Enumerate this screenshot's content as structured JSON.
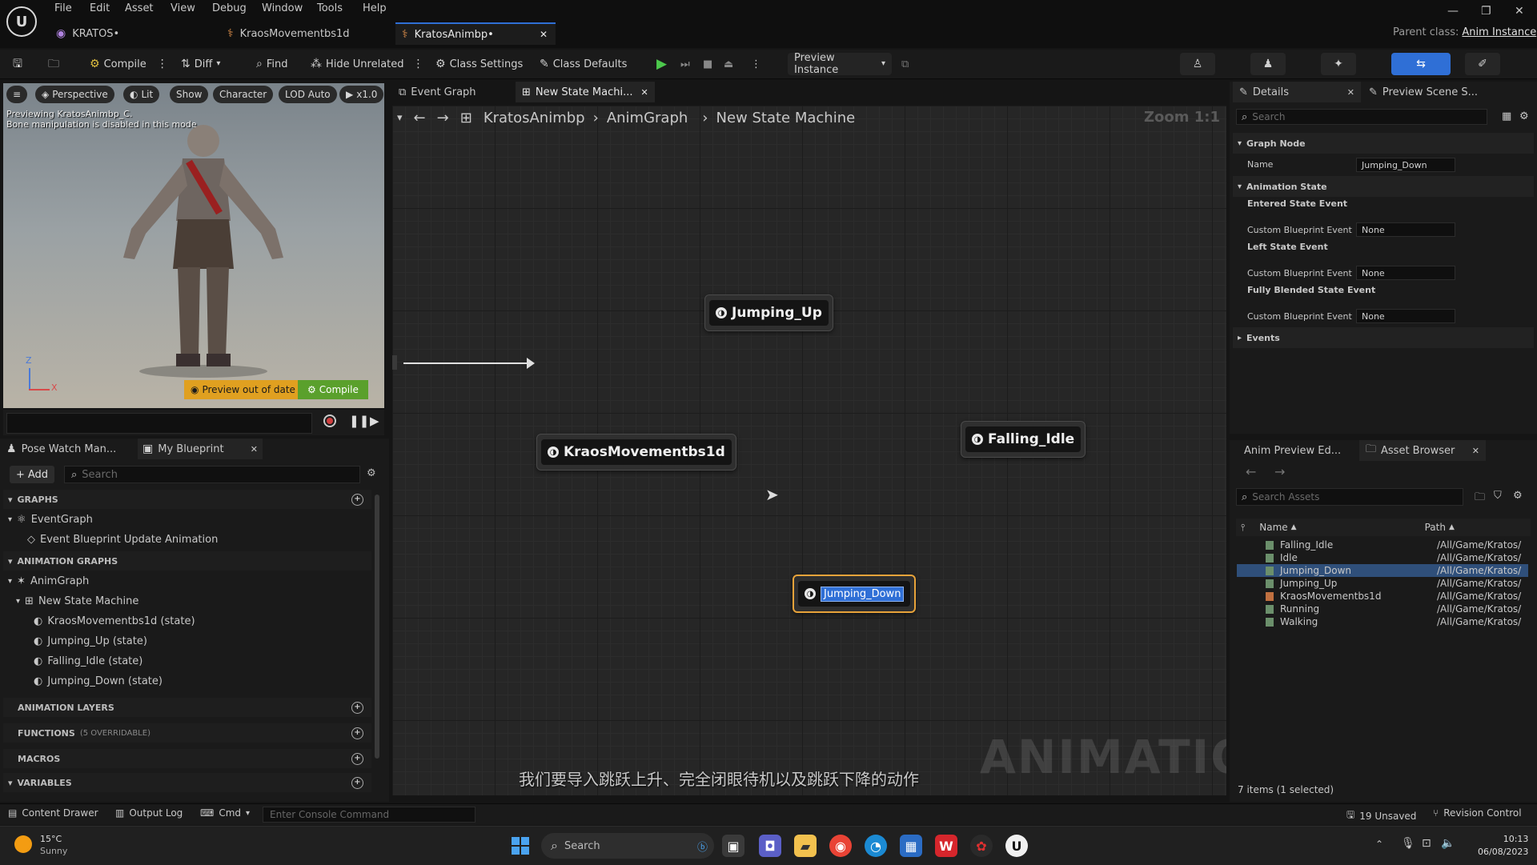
{
  "menu": [
    "File",
    "Edit",
    "Asset",
    "View",
    "Debug",
    "Window",
    "Tools",
    "Help"
  ],
  "doc_tabs": [
    {
      "label": "KRATOS•"
    },
    {
      "label": "KraosMovementbs1d"
    },
    {
      "label": "KratosAnimbp•"
    }
  ],
  "title_right": {
    "parent_label": "Parent class:",
    "parent_value": "Anim Instance"
  },
  "toolbar": {
    "compile": "Compile",
    "diff": "Diff",
    "find": "Find",
    "hide_unrelated": "Hide Unrelated",
    "class_settings": "Class Settings",
    "class_defaults": "Class Defaults",
    "preview_instance": "Preview Instance"
  },
  "viewport": {
    "buttons": [
      "Perspective",
      "Lit",
      "Show",
      "Character",
      "LOD Auto",
      "x1.0"
    ],
    "overlay_line1": "Previewing KratosAnimbp_C.",
    "overlay_line2": "Bone manipulation is disabled in this mode.",
    "preview_out_of_date": "Preview out of date",
    "compile": "Compile",
    "axis_z": "Z",
    "axis_x": "X"
  },
  "left_tabs": {
    "pose_watch": "Pose Watch Man...",
    "my_blueprint": "My Blueprint"
  },
  "my_blueprint": {
    "add": "Add",
    "search_placeholder": "Search",
    "graphs_header": "GRAPHS",
    "event_graph": "EventGraph",
    "event_update": "Event Blueprint Update Animation",
    "anim_graphs_header": "ANIMATION GRAPHS",
    "anim_graph": "AnimGraph",
    "state_machine": "New State Machine",
    "states": [
      "KraosMovementbs1d (state)",
      "Jumping_Up (state)",
      "Falling_Idle (state)",
      "Jumping_Down (state)"
    ],
    "anim_layers": "ANIMATION LAYERS",
    "functions": "FUNCTIONS",
    "functions_note": "(5 OVERRIDABLE)",
    "macros": "MACROS",
    "variables": "VARIABLES"
  },
  "graph_tabs": {
    "event_graph": "Event Graph",
    "state_machine": "New State Machi..."
  },
  "breadcrumb": [
    "KratosAnimbp",
    "AnimGraph",
    "New State Machine"
  ],
  "zoom": "Zoom 1:1",
  "nodes": {
    "jumping_up": "Jumping_Up",
    "kraos": "KraosMovementbs1d",
    "falling_idle": "Falling_Idle",
    "jumping_down": "Jumping_Down"
  },
  "watermark": "ANIMATION",
  "subtitle": "我们要导入跳跃上升、完全闭眼待机以及跳跃下降的动作",
  "details": {
    "tab": "Details",
    "preview_tab": "Preview Scene S...",
    "search_placeholder": "Search",
    "graph_node": "Graph Node",
    "name_label": "Name",
    "name_value": "Jumping_Down",
    "animation_state": "Animation State",
    "entered": "Entered State Event",
    "left": "Left State Event",
    "fully": "Fully Blended State Event",
    "custom_event": "Custom Blueprint Event",
    "none": "None",
    "events": "Events"
  },
  "asset_browser": {
    "anim_preview_tab": "Anim Preview Ed...",
    "tab": "Asset Browser",
    "search_placeholder": "Search Assets",
    "col_name": "Name",
    "col_path": "Path",
    "items": [
      {
        "name": "Falling_Idle",
        "path": "/All/Game/Kratos/"
      },
      {
        "name": "Idle",
        "path": "/All/Game/Kratos/"
      },
      {
        "name": "Jumping_Down",
        "path": "/All/Game/Kratos/"
      },
      {
        "name": "Jumping_Up",
        "path": "/All/Game/Kratos/"
      },
      {
        "name": "KraosMovementbs1d",
        "path": "/All/Game/Kratos/"
      },
      {
        "name": "Running",
        "path": "/All/Game/Kratos/"
      },
      {
        "name": "Walking",
        "path": "/All/Game/Kratos/"
      }
    ],
    "count": "7 items (1 selected)"
  },
  "status": {
    "content_drawer": "Content Drawer",
    "output_log": "Output Log",
    "cmd": "Cmd",
    "console_placeholder": "Enter Console Command",
    "unsaved": "19 Unsaved",
    "revision": "Revision Control"
  },
  "taskbar": {
    "temp": "15°C",
    "weather": "Sunny",
    "search": "Search",
    "time": "10:13",
    "date": "06/08/2023"
  },
  "colors": {
    "accent": "#2f6fd6",
    "selection": "#e8a33a",
    "compile_green": "#5aa02c",
    "preview_yellow": "#e0a020"
  }
}
